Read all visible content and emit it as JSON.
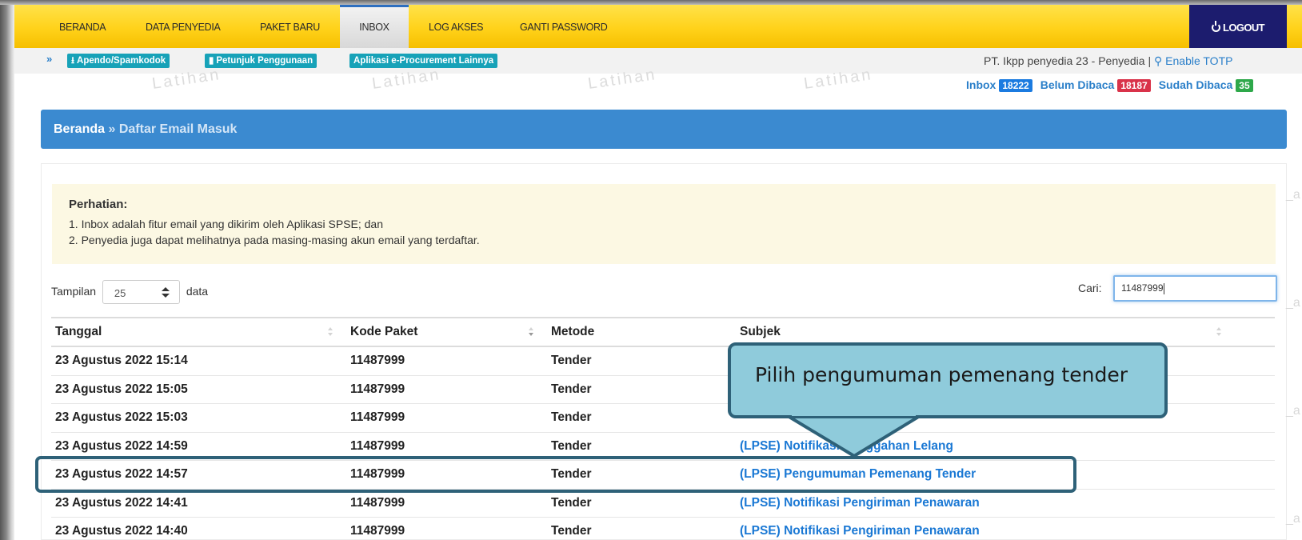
{
  "nav": {
    "items": [
      "BERANDA",
      "DATA PENYEDIA",
      "PAKET BARU",
      "INBOX",
      "LOG AKSES",
      "GANTI PASSWORD"
    ],
    "active": "INBOX",
    "logout": "LOGOUT"
  },
  "toolbar": {
    "apendo": "Apendo/Spamkodok",
    "petunjuk": "Petunjuk Penggunaan",
    "aplikasi": "Aplikasi e-Procurement Lainnya"
  },
  "user": {
    "info": "PT. Ikpp penyedia 23 - Penyedia | ",
    "totp": "Enable TOTP"
  },
  "watermark": "Latihan",
  "counts": {
    "inbox_label": "Inbox",
    "inbox_value": "18222",
    "unread_label": "Belum Dibaca",
    "unread_value": "18187",
    "read_label": "Sudah Dibaca",
    "read_value": "35"
  },
  "breadcrumb": {
    "home": "Beranda",
    "sep": "»",
    "current": "Daftar Email Masuk"
  },
  "notice": {
    "title": "Perhatian:",
    "line1": "1. Inbox adalah fitur email yang dikirim oleh Aplikasi SPSE; dan",
    "line2": "2. Penyedia juga dapat melihatnya pada masing-masing akun email yang terdaftar."
  },
  "list_controls": {
    "show_label": "Tampilan",
    "show_value": "25",
    "show_suffix": "data",
    "search_label": "Cari:",
    "search_value": "11487999"
  },
  "table": {
    "headers": [
      "Tanggal",
      "Kode Paket",
      "Metode",
      "Subjek"
    ],
    "rows": [
      {
        "tanggal": "23 Agustus 2022 15:14",
        "kode": "11487999",
        "metode": "Tender",
        "subjek": ""
      },
      {
        "tanggal": "23 Agustus 2022 15:05",
        "kode": "11487999",
        "metode": "Tender",
        "subjek": ""
      },
      {
        "tanggal": "23 Agustus 2022 15:03",
        "kode": "11487999",
        "metode": "Tender",
        "subjek": ""
      },
      {
        "tanggal": "23 Agustus 2022 14:59",
        "kode": "11487999",
        "metode": "Tender",
        "subjek": "(LPSE) Notifikasi Sanggahan Lelang"
      },
      {
        "tanggal": "23 Agustus 2022 14:57",
        "kode": "11487999",
        "metode": "Tender",
        "subjek": "(LPSE) Pengumuman Pemenang Tender"
      },
      {
        "tanggal": "23 Agustus 2022 14:41",
        "kode": "11487999",
        "metode": "Tender",
        "subjek": "(LPSE) Notifikasi Pengiriman Penawaran"
      },
      {
        "tanggal": "23 Agustus 2022 14:40",
        "kode": "11487999",
        "metode": "Tender",
        "subjek": "(LPSE) Notifikasi Pengiriman Penawaran"
      }
    ]
  },
  "callout": {
    "text": "Pilih pengumuman pemenang tender"
  },
  "colors": {
    "nav_yellow": "#ffd21a",
    "logout_navy": "#1c1c6e",
    "breadcrumb_blue": "#3b8ad0",
    "link_blue": "#1a78d4",
    "callout_fill": "#8fcbdb",
    "callout_border": "#2e6178"
  },
  "icons": [
    "power-icon",
    "chevron-up-icon",
    "download-icon",
    "book-icon",
    "key-icon",
    "sort-icon"
  ]
}
